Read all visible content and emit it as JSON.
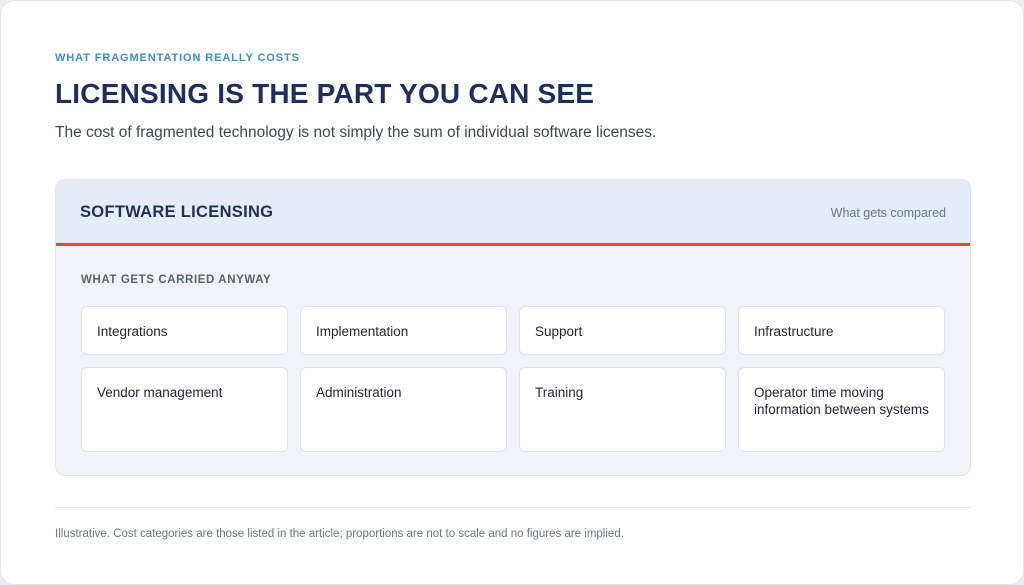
{
  "header": {
    "eyebrow": "WHAT FRAGMENTATION REALLY COSTS",
    "title": "LICENSING IS THE PART YOU CAN SEE",
    "subtitle": "The cost of fragmented technology is not simply the sum of individual software licenses."
  },
  "panel": {
    "title": "SOFTWARE LICENSING",
    "note": "What gets compared",
    "accent_color": "#e4472c",
    "section_label": "WHAT GETS CARRIED ANYWAY",
    "items": [
      {
        "label": "Integrations"
      },
      {
        "label": "Implementation"
      },
      {
        "label": "Support"
      },
      {
        "label": "Infrastructure"
      },
      {
        "label": "Vendor management"
      },
      {
        "label": "Administration"
      },
      {
        "label": "Training"
      },
      {
        "label": "Operator time moving information between systems"
      }
    ]
  },
  "footnote": "Illustrative. Cost categories are those listed in the article; proportions are not to scale and no figures are implied."
}
